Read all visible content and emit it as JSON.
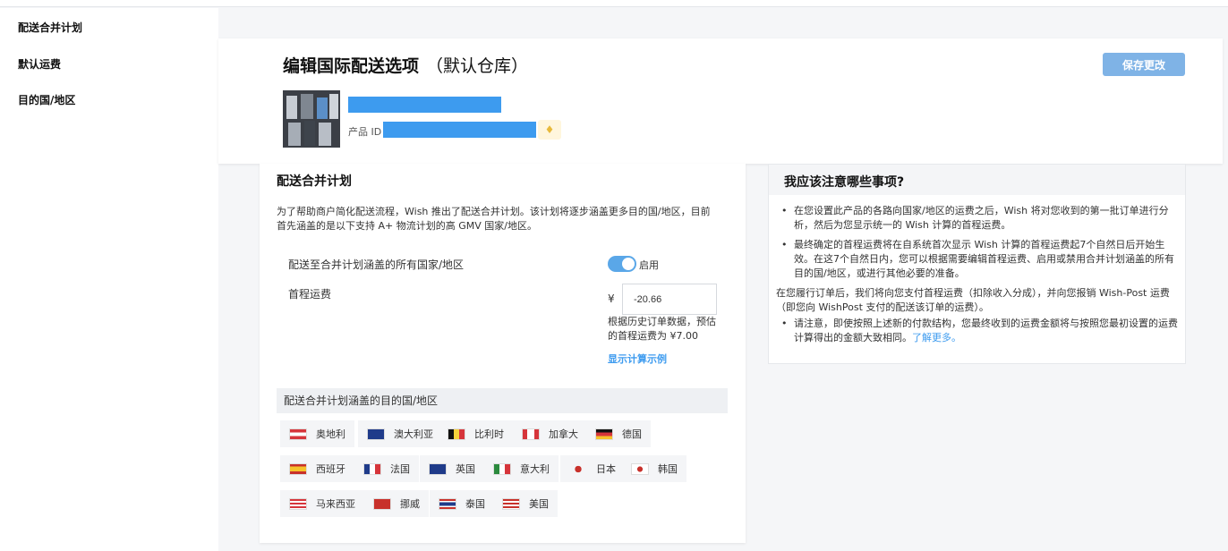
{
  "sidebar": {
    "items": [
      {
        "label": "配送合并计划"
      },
      {
        "label": "默认运费"
      },
      {
        "label": "目的国/地区"
      }
    ]
  },
  "header": {
    "title": "编辑国际配送选项",
    "subtitle": "（默认仓库）",
    "save_label": "保存更改",
    "product_id_label": "产品 ID"
  },
  "merge_plan": {
    "title": "配送合并计划",
    "description": "为了帮助商户简化配送流程，Wish 推出了配送合并计划。该计划将逐步涵盖更多目的国/地区，目前首先涵盖的是以下支持 A+ 物流计划的高 GMV 国家/地区。",
    "toggle_row_label": "配送至合并计划涵盖的所有国家/地区",
    "toggle_text": "启用",
    "toggle_on": true,
    "fee_label": "首程运费",
    "currency_symbol": "¥",
    "fee_value": "-20.66",
    "estimate_text": "根据历史订单数据，预估的首程运费为 ¥7.00",
    "example_link": "显示计算示例",
    "regions_header": "配送合并计划涵盖的目的国/地区",
    "regions": [
      {
        "name": "奥地利",
        "flag": "austria-flag"
      },
      {
        "name": "澳大利亚",
        "flag": "australia-flag"
      },
      {
        "name": "比利时",
        "flag": "belgium-flag"
      },
      {
        "name": "加拿大",
        "flag": "canada-flag"
      },
      {
        "name": "德国",
        "flag": "germany-flag"
      },
      {
        "name": "西班牙",
        "flag": "spain-flag"
      },
      {
        "name": "法国",
        "flag": "france-flag"
      },
      {
        "name": "英国",
        "flag": "uk-flag"
      },
      {
        "name": "意大利",
        "flag": "italy-flag"
      },
      {
        "name": "日本",
        "flag": "japan-flag"
      },
      {
        "name": "韩国",
        "flag": "korea-flag"
      },
      {
        "name": "马来西亚",
        "flag": "malaysia-flag"
      },
      {
        "name": "挪威",
        "flag": "norway-flag"
      },
      {
        "name": "泰国",
        "flag": "thailand-flag"
      },
      {
        "name": "美国",
        "flag": "usa-flag"
      }
    ]
  },
  "notes": {
    "title": "我应该注意哪些事项?",
    "bullet1": "在您设置此产品的各路向国家/地区的运费之后，Wish 将对您收到的第一批订单进行分析，然后为您显示统一的 Wish 计算的首程运费。",
    "bullet2": "最终确定的首程运费将在自系统首次显示 Wish 计算的首程运费起7个自然日后开始生效。在这7个自然日内，您可以根据需要编辑首程运费、启用或禁用合并计划涵盖的所有目的国/地区，或进行其他必要的准备。",
    "paragraph": "在您履行订单后，我们将向您支付首程运费（扣除收入分成），并向您报销 Wish-Post 运费（即您向 WishPost 支付的配送该订单的运费）。",
    "bullet3": "请注意，即使按照上述新的付款结构，您最终收到的运费金额将与按照您最初设置的运费计算得出的金额大致相同。",
    "learn_more": "了解更多。"
  },
  "colors": {
    "accent": "#3d9bef",
    "save_button": "#7fb3e6",
    "toggle_on": "#5aa7e8"
  }
}
